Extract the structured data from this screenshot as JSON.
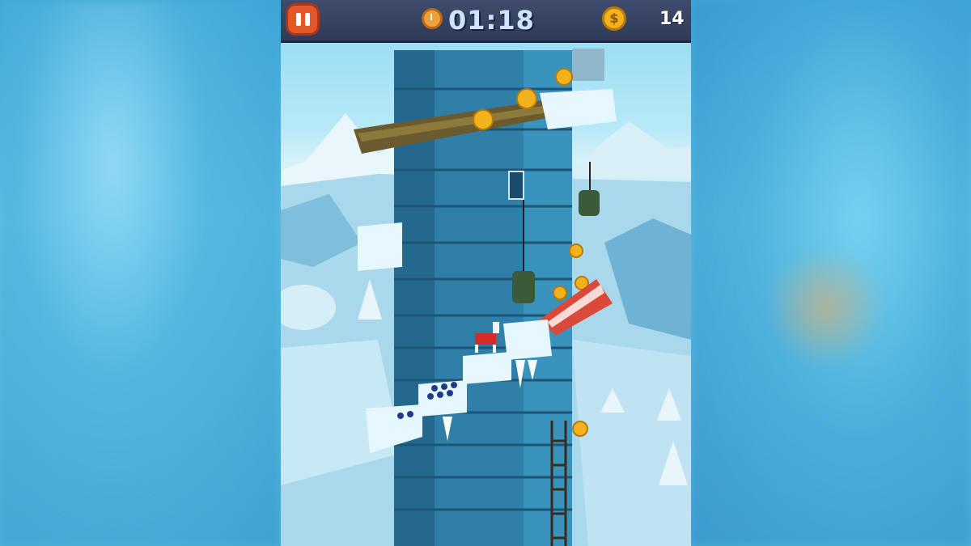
{
  "hud": {
    "pause_icon": "pause-icon",
    "timer_icon": "stopwatch-icon",
    "timer": "01:18",
    "coin_icon": "coin-icon",
    "coin_symbol": "$",
    "coin_count": "14"
  },
  "colors": {
    "hud_bg": "#2f3a58",
    "pause_button": "#e4572a",
    "tower": "#2f7fa8",
    "coin": "#f3b21c",
    "snow": "#e6f7ff"
  }
}
